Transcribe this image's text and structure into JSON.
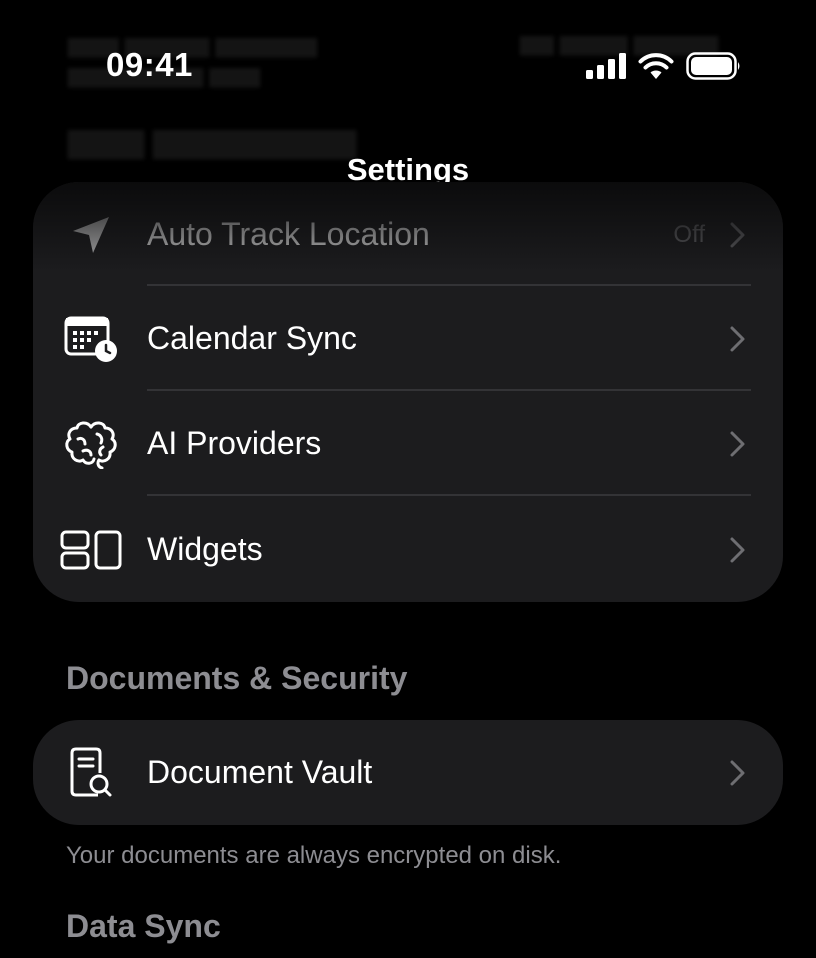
{
  "status_bar": {
    "time": "09:41"
  },
  "nav": {
    "title": "Settings"
  },
  "sections": {
    "app_features": {
      "items": [
        {
          "label": "Auto Track Location",
          "value": "Off",
          "icon": "location-arrow-icon"
        },
        {
          "label": "Calendar Sync",
          "icon": "calendar-clock-icon"
        },
        {
          "label": "AI Providers",
          "icon": "brain-icon"
        },
        {
          "label": "Widgets",
          "icon": "widgets-icon"
        }
      ]
    },
    "documents_security": {
      "title": "Documents & Security",
      "items": [
        {
          "label": "Document Vault",
          "icon": "document-search-icon"
        }
      ],
      "footnote": "Your documents are always encrypted on disk."
    },
    "data_sync": {
      "title": "Data Sync"
    }
  },
  "colors": {
    "background": "#000000",
    "card": "#1c1c1e",
    "secondary_text": "#8d8d92",
    "divider": "#333336"
  }
}
